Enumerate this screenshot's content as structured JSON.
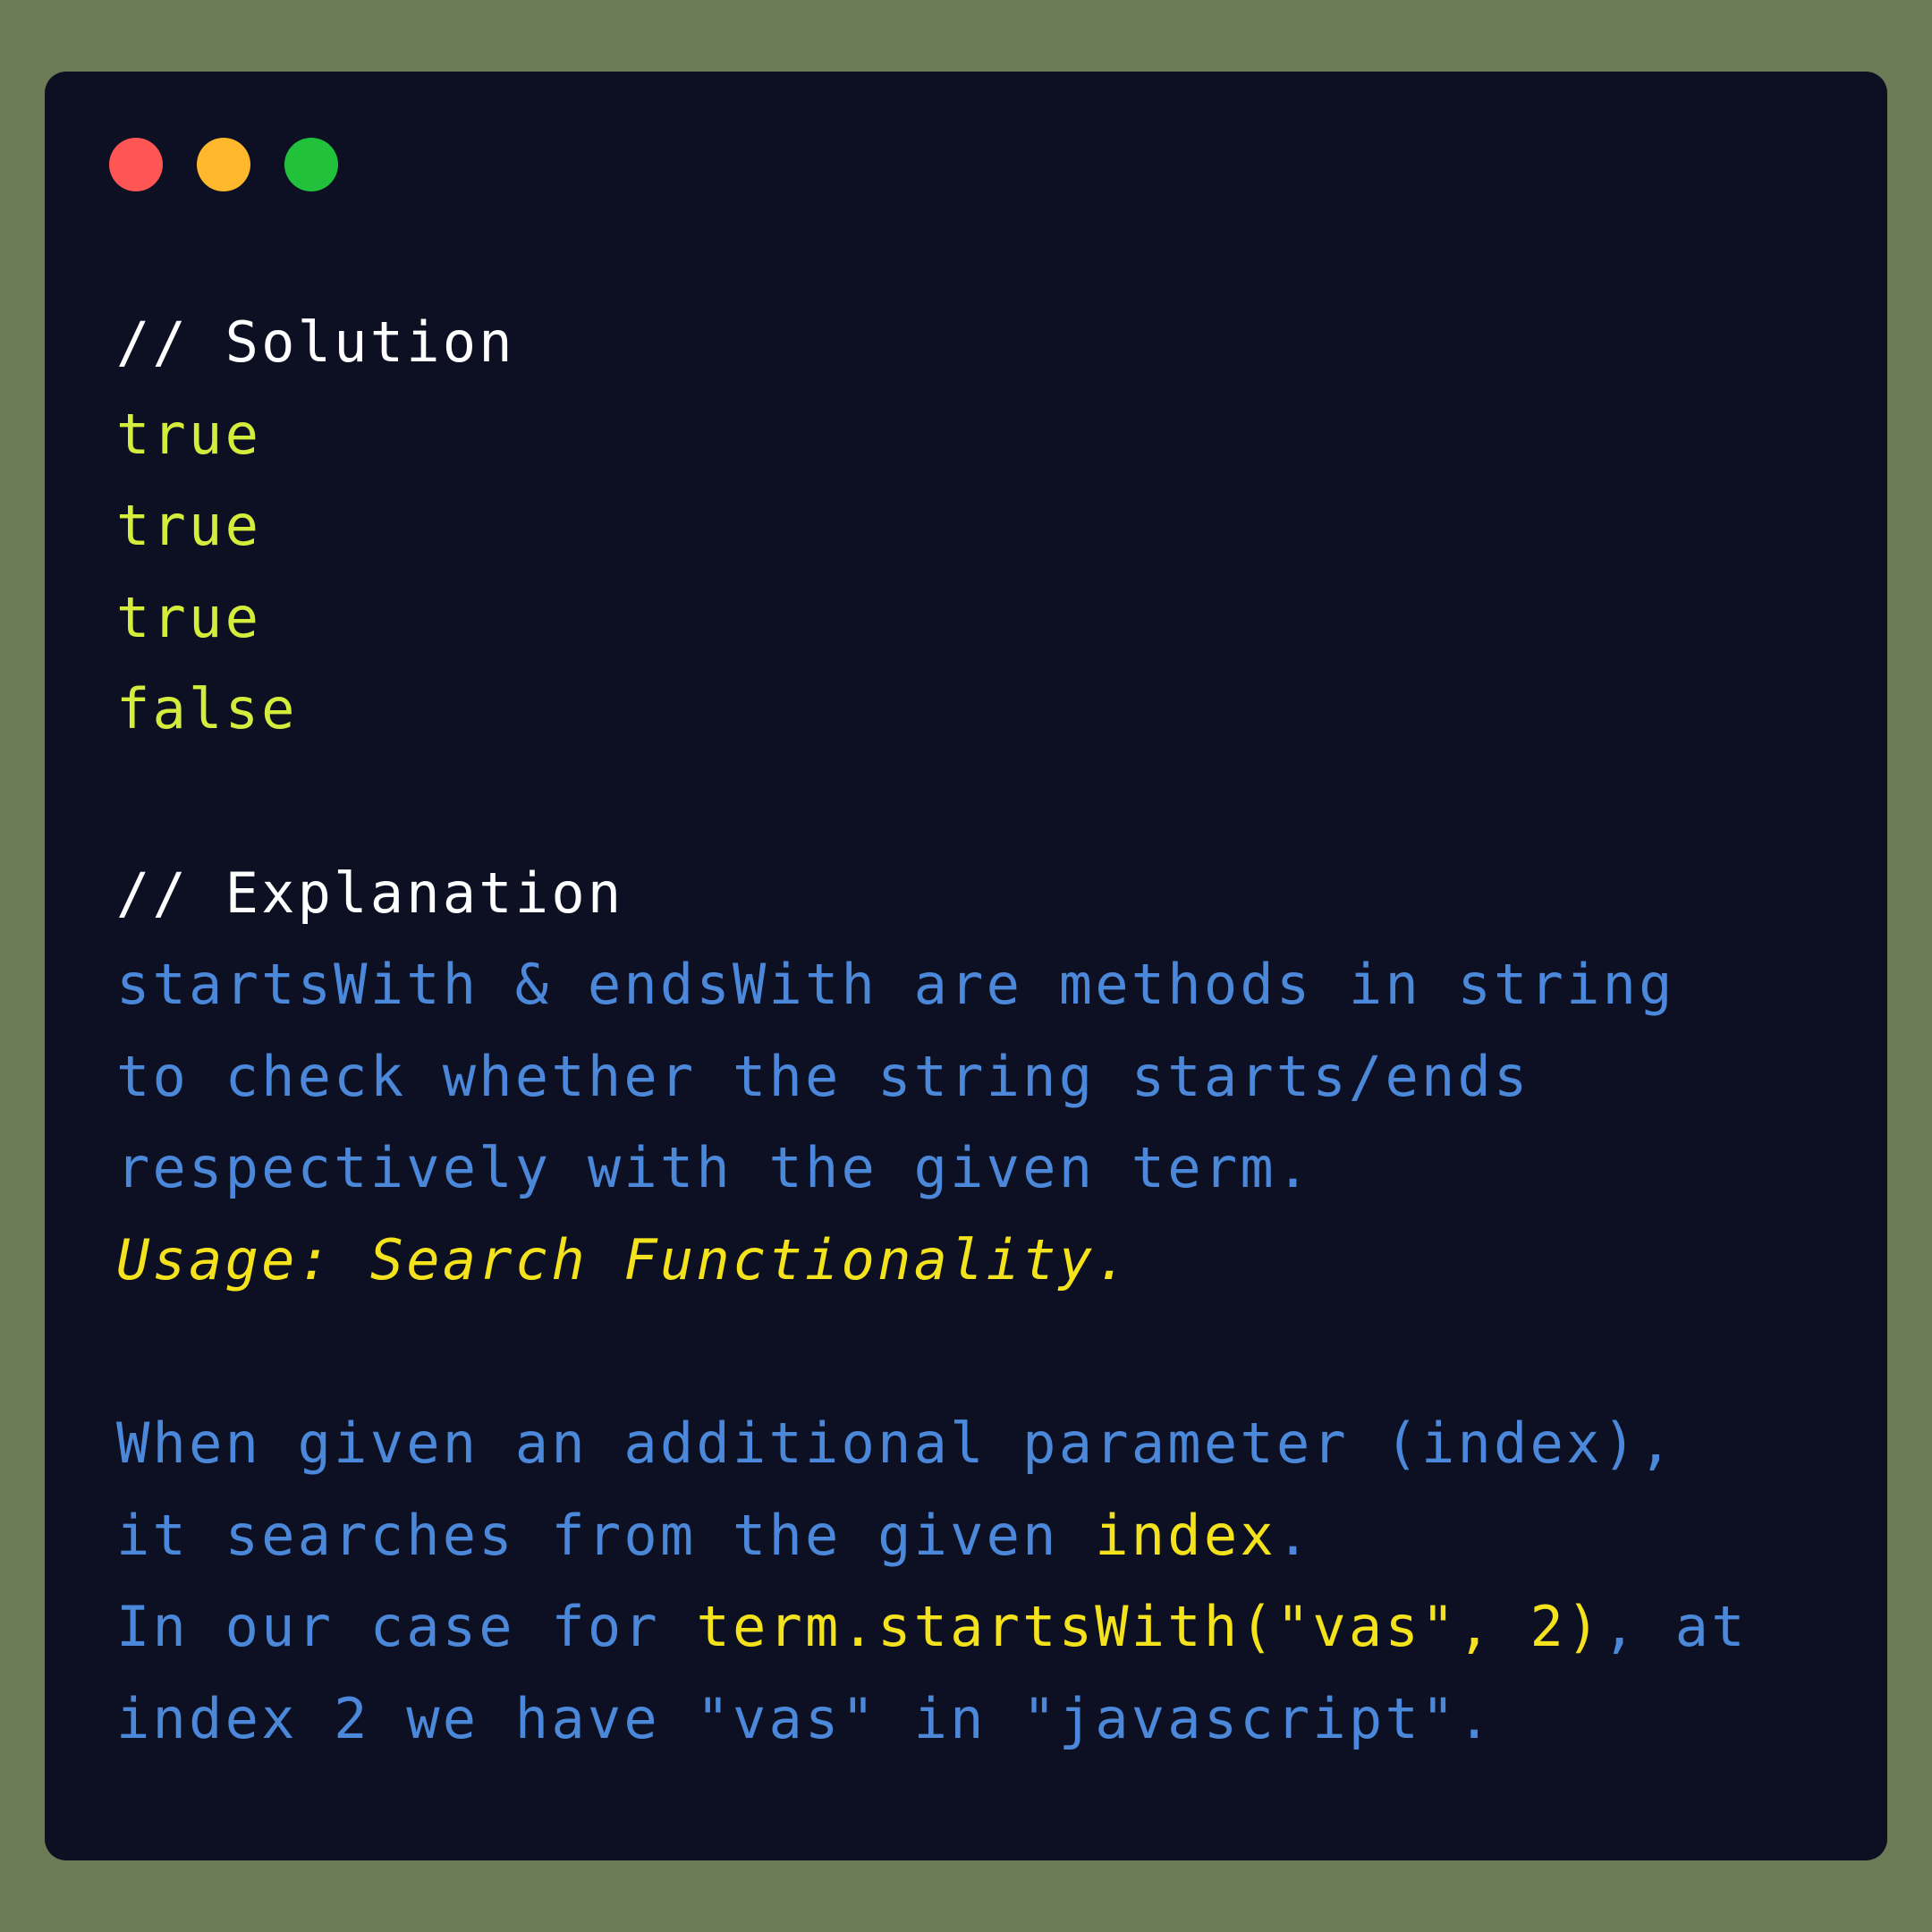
{
  "colors": {
    "background": "#6b7b56",
    "window": "#0c1022",
    "comment": "#ffffff",
    "boolean": "#d4ec3c",
    "text": "#4b88d9",
    "highlight": "#f4e21c",
    "close": "#fe5555",
    "minimize": "#ffb82b",
    "maximize": "#22c13b"
  },
  "code": {
    "solution_comment": "// Solution",
    "results": [
      "true",
      "true",
      "true",
      "false"
    ],
    "explanation_comment": "// Explanation",
    "explanation_lines": [
      "startsWith & endsWith are methods in string",
      "to check whether the string starts/ends",
      "respectively with the given term."
    ],
    "usage": "Usage: Search Functionality.",
    "param_line": "When given an additional parameter (index),",
    "index_line": {
      "prefix": "it searches from the given ",
      "highlight": "index",
      "suffix": "."
    },
    "case_line": {
      "prefix": "In our case for ",
      "highlight": "term.startsWith(\"vas\", 2)",
      "suffix": ", at"
    },
    "final_line": "index 2 we have \"vas\" in \"javascript\"."
  }
}
